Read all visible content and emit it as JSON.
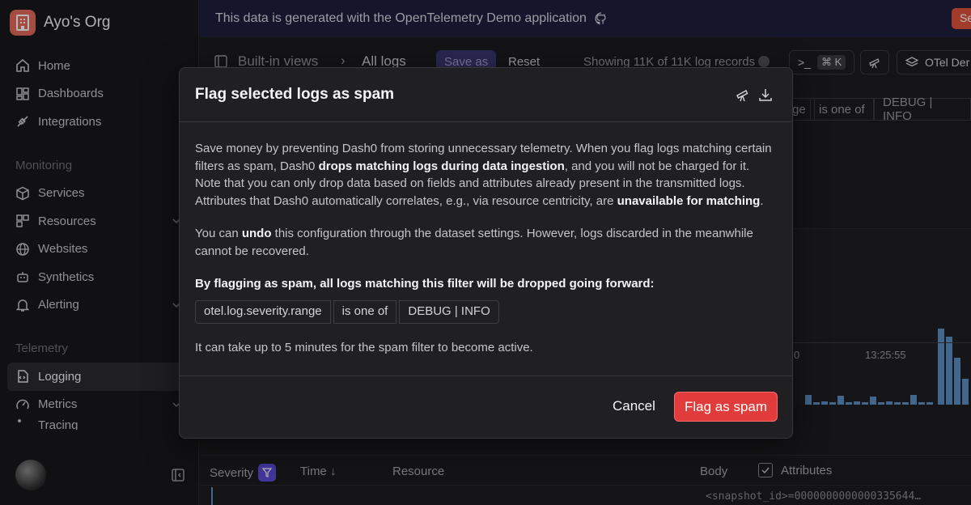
{
  "org": {
    "name": "Ayo's Org"
  },
  "nav": {
    "home": "Home",
    "dashboards": "Dashboards",
    "integrations": "Integrations",
    "section_monitoring": "Monitoring",
    "services": "Services",
    "resources": "Resources",
    "websites": "Websites",
    "synthetics": "Synthetics",
    "alerting": "Alerting",
    "section_telemetry": "Telemetry",
    "logging": "Logging",
    "metrics": "Metrics",
    "tracing": "Tracing"
  },
  "banner": {
    "text": "This data is generated with the OpenTelemetry Demo application",
    "button": "Se"
  },
  "toolbar": {
    "builtin_views": "Built-in views",
    "all_logs": "All logs",
    "save_as": "Save as",
    "reset": "Reset",
    "showing": "Showing 11K of 11K log records",
    "shortcut": "⌘ K",
    "dataset": "OTel Der"
  },
  "bg_filter": {
    "field_tail": "ge",
    "operator": "is one of",
    "value": "DEBUG | INFO"
  },
  "chart": {
    "x_tick_1": "0",
    "x_tick_2": "13:25:55"
  },
  "table": {
    "severity": "Severity",
    "time": "Time ↓",
    "resource": "Resource",
    "body": "Body",
    "attributes": "Attributes",
    "snapshot_cell": "<snapshot_id>=0000000000000335644…"
  },
  "modal": {
    "title": "Flag selected logs as spam",
    "p1_a": "Save money by preventing Dash0 from storing unnecessary telemetry. When you flag logs matching certain filters as spam, Dash0 ",
    "p1_b": "drops matching logs during data ingestion",
    "p1_c": ", and you will not be charged for it. Note that you can only drop data based on fields and attributes already present in the transmitted logs. Attributes that Dash0 automatically correlates, e.g., via resource centricity, are ",
    "p1_d": "unavailable for matching",
    "p1_e": ".",
    "p2_a": "You can ",
    "p2_b": "undo",
    "p2_c": " this configuration through the dataset settings. However, logs discarded in the meanwhile cannot be recovered.",
    "p3": "By flagging as spam, all logs matching this filter will be dropped going forward:",
    "filter": {
      "field": "otel.log.severity.range",
      "operator": "is one of",
      "value": "DEBUG | INFO"
    },
    "p4": "It can take up to 5 minutes for the spam filter to become active.",
    "cancel": "Cancel",
    "confirm": "Flag as spam"
  }
}
